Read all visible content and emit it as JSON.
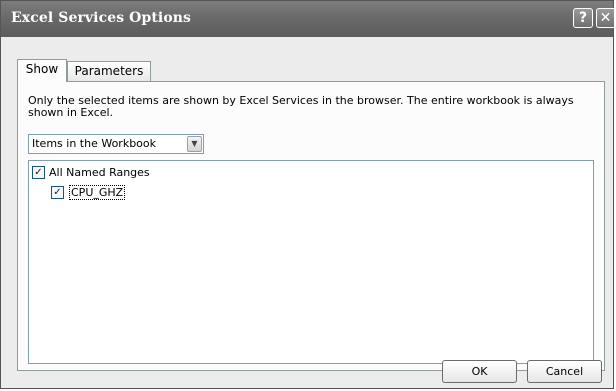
{
  "window": {
    "title": "Excel Services Options",
    "help_glyph": "?",
    "close_glyph": "✕"
  },
  "tabs": [
    {
      "label": "Show",
      "active": true
    },
    {
      "label": "Parameters",
      "active": false
    }
  ],
  "show_panel": {
    "description": "Only the selected items are shown by Excel Services in the browser. The entire workbook is always shown in Excel.",
    "dropdown": {
      "selected": "Items in the Workbook",
      "arrow_icon": "chevron-down-icon"
    },
    "tree": [
      {
        "label": "All Named Ranges",
        "checked": true,
        "level": 0
      },
      {
        "label": "CPU_GHZ",
        "checked": true,
        "level": 1
      }
    ]
  },
  "footer": {
    "ok_label": "OK",
    "cancel_label": "Cancel"
  },
  "colors": {
    "titlebar": "#6a6a6a",
    "dialog_bg": "#ececec",
    "panel_bg": "#fcfcfc",
    "border": "#7f9db9"
  },
  "glyphs": {
    "check": "✓",
    "dropdown_arrow": "▼"
  }
}
